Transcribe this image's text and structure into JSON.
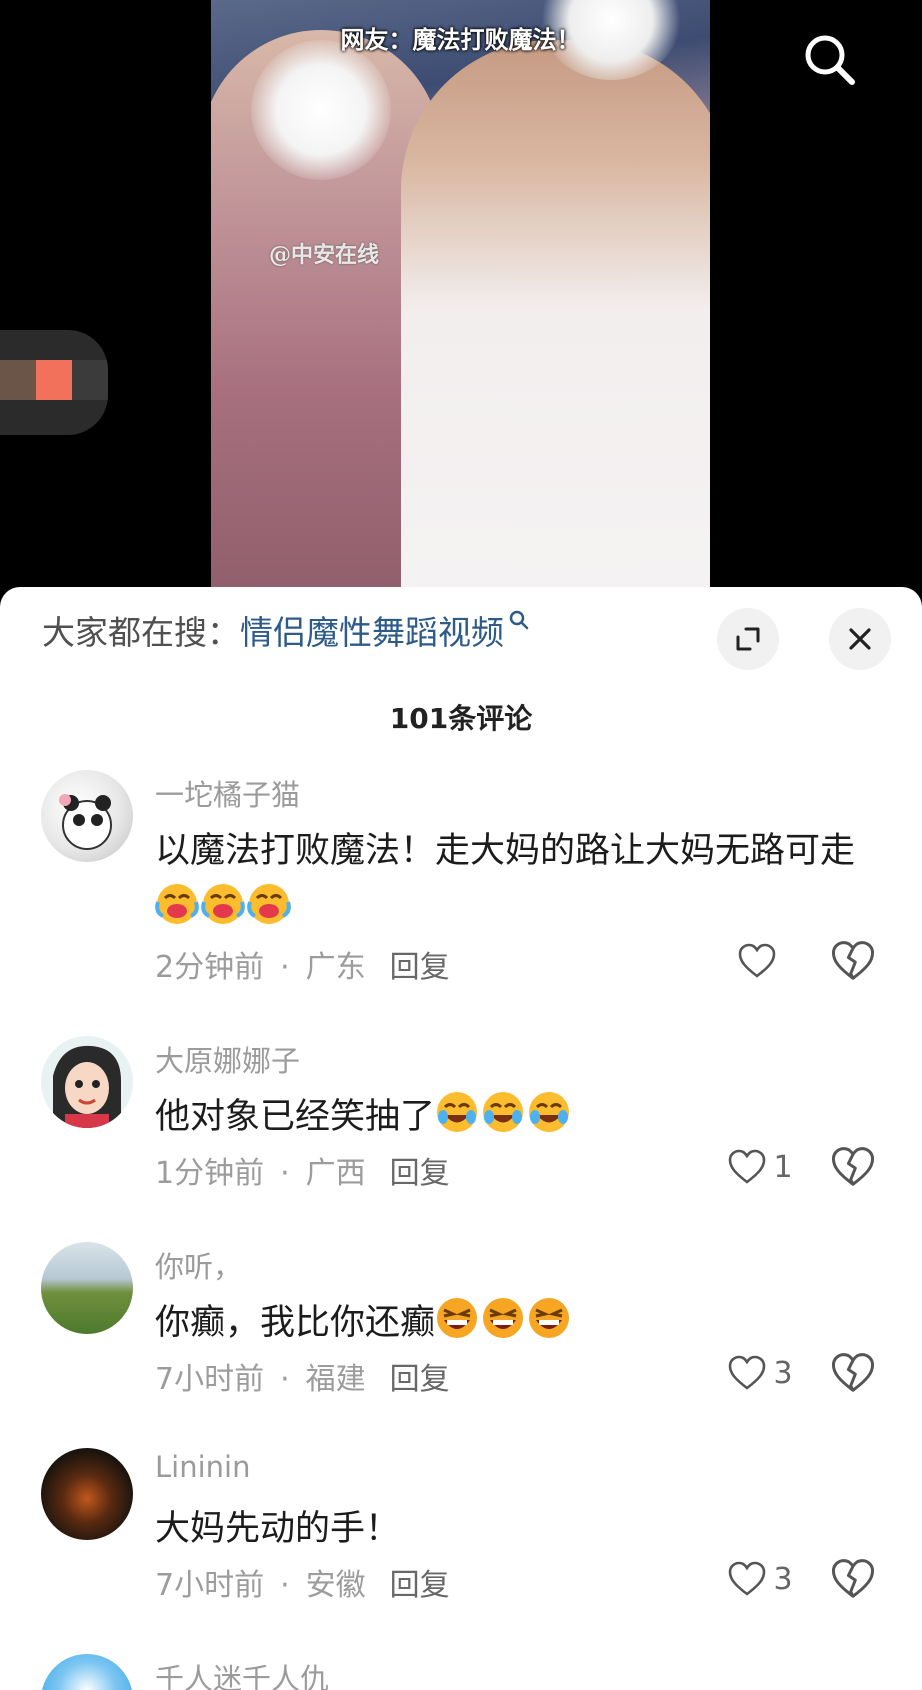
{
  "video": {
    "caption": "网友：魔法打败魔法！",
    "watermark": "@中安在线"
  },
  "search_bar": {
    "prefix": "大家都在搜：",
    "query": "情侣魔性舞蹈视频"
  },
  "comment_count": "101条评论",
  "comments": [
    {
      "user": "一坨橘子猫",
      "text": "以魔法打败魔法！走大妈的路让大妈无路可走",
      "emoji": "crying-laughing",
      "time": "2分钟前",
      "location": "广东",
      "reply": "回复",
      "likes": ""
    },
    {
      "user": "大原娜娜子",
      "text": "他对象已经笑抽了",
      "emoji": "laugh-tears",
      "time": "1分钟前",
      "location": "广西",
      "reply": "回复",
      "likes": "1"
    },
    {
      "user": "你听，",
      "text": "你癫，我比你还癫",
      "emoji": "grin",
      "time": "7小时前",
      "location": "福建",
      "reply": "回复",
      "likes": "3"
    },
    {
      "user": "Lininin",
      "text": "大妈先动的手！",
      "emoji": "",
      "time": "7小时前",
      "location": "安徽",
      "reply": "回复",
      "likes": "3"
    },
    {
      "user": "千人迷千人仇",
      "text": "",
      "emoji": "",
      "time": "",
      "location": "",
      "reply": "",
      "likes": ""
    }
  ],
  "colors": {
    "search_link": "#2d5b8a",
    "text": "#1c1c1c",
    "muted": "#9c9c9c"
  }
}
